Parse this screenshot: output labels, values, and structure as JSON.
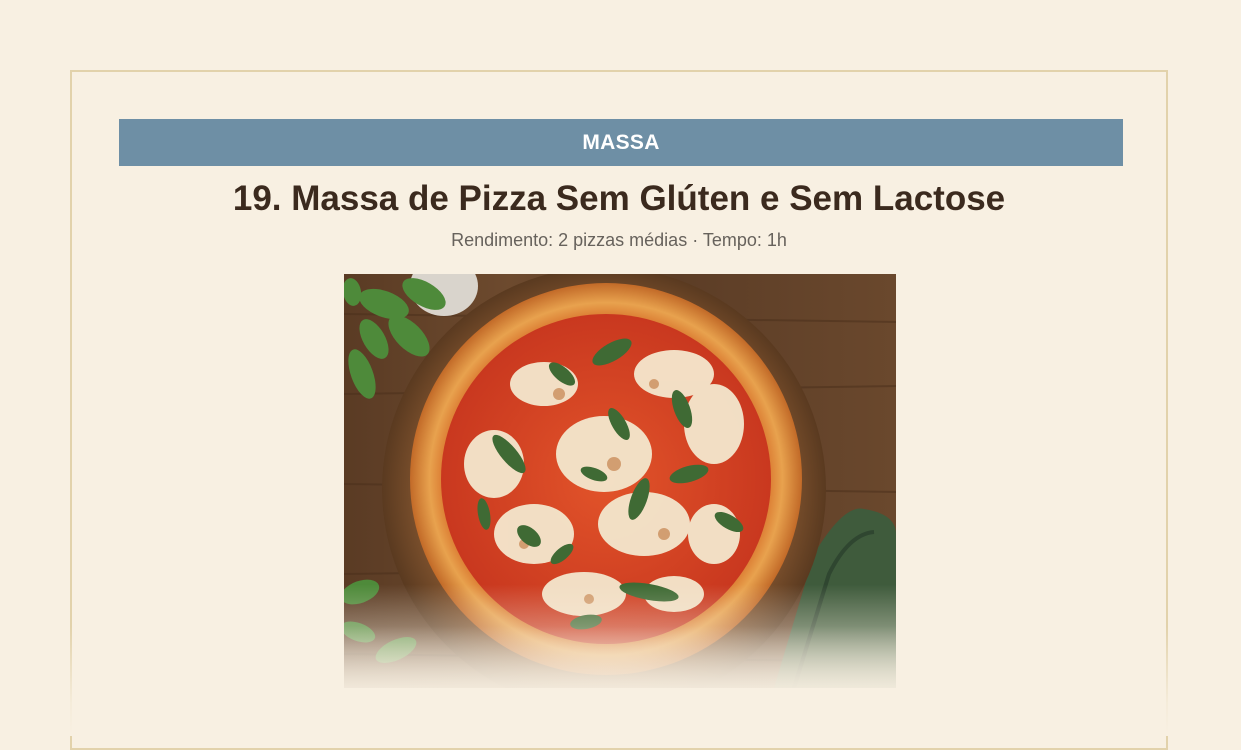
{
  "recipe": {
    "category": "MASSA",
    "title": "19. Massa de Pizza Sem Glúten e Sem Lactose",
    "meta": "Rendimento: 2 pizzas médias · Tempo: 1h"
  },
  "photo": {
    "subject": "pizza-margherita-photo"
  },
  "colors": {
    "background": "#f8f0e2",
    "card_border": "#e2d2ab",
    "category_bar": "#6e8fa5",
    "title_text": "#3b2a1e",
    "meta_text": "#67625c"
  }
}
